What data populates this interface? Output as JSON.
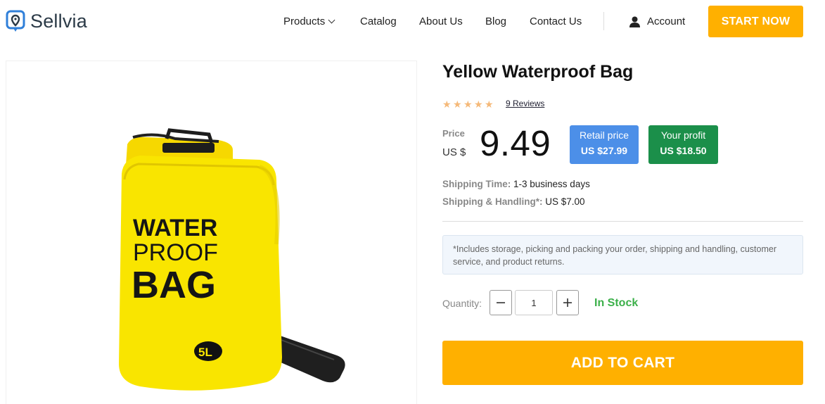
{
  "header": {
    "logo_text": "Sellvia",
    "nav": {
      "products": "Products",
      "catalog": "Catalog",
      "about": "About Us",
      "blog": "Blog",
      "contact": "Contact Us"
    },
    "account_label": "Account",
    "cta_label": "START NOW"
  },
  "product": {
    "title": "Yellow Waterproof Bag",
    "rating_stars": 5,
    "reviews_label": "9 Reviews",
    "price_label": "Price",
    "currency": "US $",
    "price": "9.49",
    "retail": {
      "label": "Retail price",
      "value": "US $27.99"
    },
    "profit": {
      "label": "Your profit",
      "value": "US $18.50"
    },
    "shipping_time_label": "Shipping Time:",
    "shipping_time_value": "1-3 business days",
    "shipping_handling_label": "Shipping & Handling*:",
    "shipping_handling_value": "US $7.00",
    "note": "*Includes storage, picking and packing your order, shipping and handling, customer service, and product returns.",
    "quantity_label": "Quantity:",
    "quantity_value": "1",
    "stock_status": "In Stock",
    "add_to_cart_label": "ADD TO CART",
    "image_text": {
      "line1": "WATER",
      "line2": "PROOF",
      "line3": "BAG",
      "size": "5L"
    }
  },
  "colors": {
    "accent": "#ffb000",
    "retail_badge": "#4c8fe8",
    "profit_badge": "#1b8f4a",
    "in_stock": "#3cb04a",
    "star": "#f5b979"
  }
}
